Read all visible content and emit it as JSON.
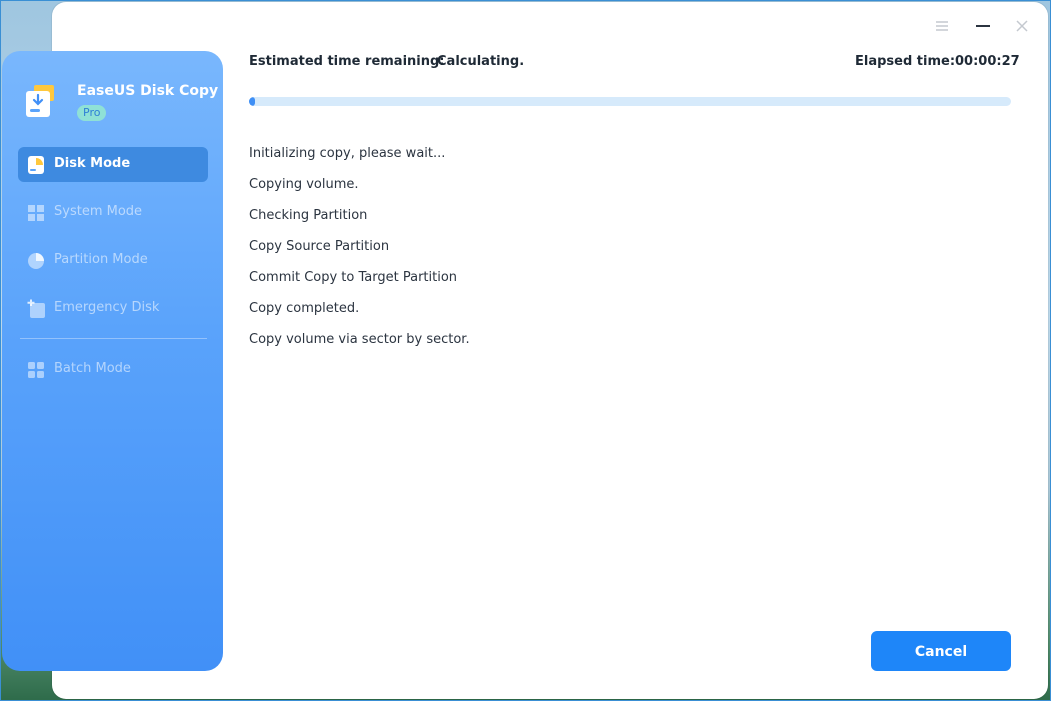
{
  "app": {
    "name": "EaseUS Disk Copy",
    "edition_badge": "Pro"
  },
  "window_controls": {
    "menu_icon": "menu-icon",
    "minimize_icon": "minimize-icon",
    "close_icon": "close-icon"
  },
  "sidebar": {
    "items": [
      {
        "label": "Disk Mode",
        "icon": "disk-icon",
        "active": true
      },
      {
        "label": "System Mode",
        "icon": "windows-icon",
        "active": false
      },
      {
        "label": "Partition Mode",
        "icon": "pie-icon",
        "active": false
      },
      {
        "label": "Emergency Disk",
        "icon": "emergency-disk-icon",
        "active": false
      },
      {
        "label": "Batch Mode",
        "icon": "grid-icon",
        "active": false
      }
    ]
  },
  "status": {
    "estimated_label": "Estimated time remaining:",
    "estimated_value": "Calculating.",
    "elapsed_label": "Elapsed time:",
    "elapsed_value": "00:00:27",
    "progress_fraction": 0.007
  },
  "log": [
    "Initializing copy, please wait...",
    "Copying volume.",
    "Checking Partition",
    "Copy Source Partition",
    "Commit Copy to Target Partition",
    "Copy completed.",
    "Copy volume via sector by sector."
  ],
  "actions": {
    "cancel_label": "Cancel"
  },
  "colors": {
    "accent": "#1e86f9",
    "sidebar_top": "#79b7fd",
    "sidebar_bottom": "#4190f7",
    "progress_track": "#d6eafb"
  }
}
